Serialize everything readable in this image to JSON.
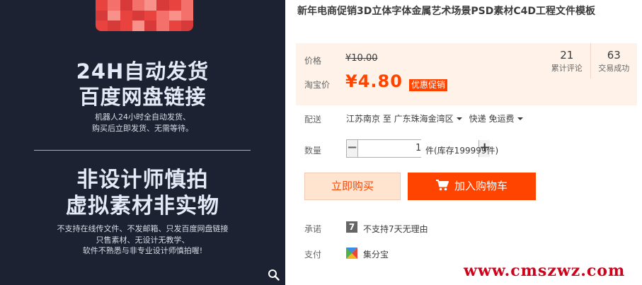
{
  "banner": {
    "headline1": "24H自动发货",
    "headline2": "百度网盘链接",
    "sub1": "机器人24小时全自动发货、",
    "sub2": "购买后立即发货、无需等待。",
    "headline3": "非设计师慎拍",
    "headline4": "虚拟素材非实物",
    "sub3": "不支持在线传文件、不发邮箱、只发百度网盘链接",
    "sub4": "只售素材、无设计无教学、",
    "sub5": "软件不熟悉与非专业设计师慎拍喔!",
    "zoom_icon": "magnifier-icon"
  },
  "product": {
    "title": "新年电商促销3D立体字体金属艺术场景PSD素材C4D工程文件模板"
  },
  "price": {
    "label": "价格",
    "original": "¥10.00",
    "taobao_label": "淘宝价",
    "current": "¥4.80",
    "promo_badge": "优惠促销",
    "accent": "#ff4400"
  },
  "stats": [
    {
      "value": "21",
      "label": "累计评论"
    },
    {
      "value": "63",
      "label": "交易成功"
    }
  ],
  "shipping": {
    "label": "配送",
    "from": "江苏南京 至",
    "to": "广东珠海金湾区",
    "method": "快递 免运费"
  },
  "quantity": {
    "label": "数量",
    "value": "1",
    "minus": "−",
    "plus": "+",
    "stock": "件(库存199999件)"
  },
  "actions": {
    "buy_now": "立即购买",
    "add_to_cart": "加入购物车"
  },
  "promise": {
    "label": "承诺",
    "icon_text": "7",
    "text": "不支持7天无理由"
  },
  "payment": {
    "label": "支付",
    "text": "集分宝"
  },
  "watermark": "www.cmszwz.com"
}
